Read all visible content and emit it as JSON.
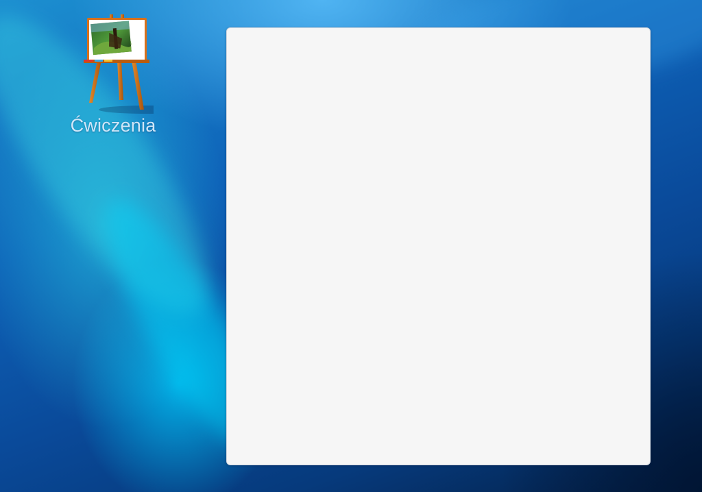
{
  "desktop": {
    "icons": [
      {
        "label": "Ćwiczenia",
        "icon": "easel-painting-icon"
      }
    ]
  },
  "panel": {
    "content": ""
  },
  "colors": {
    "desktop_background": "#0e62b8",
    "panel_background": "#f6f6f6",
    "icon_label": "#cfe6f8",
    "easel_wood": "#c96a12"
  }
}
